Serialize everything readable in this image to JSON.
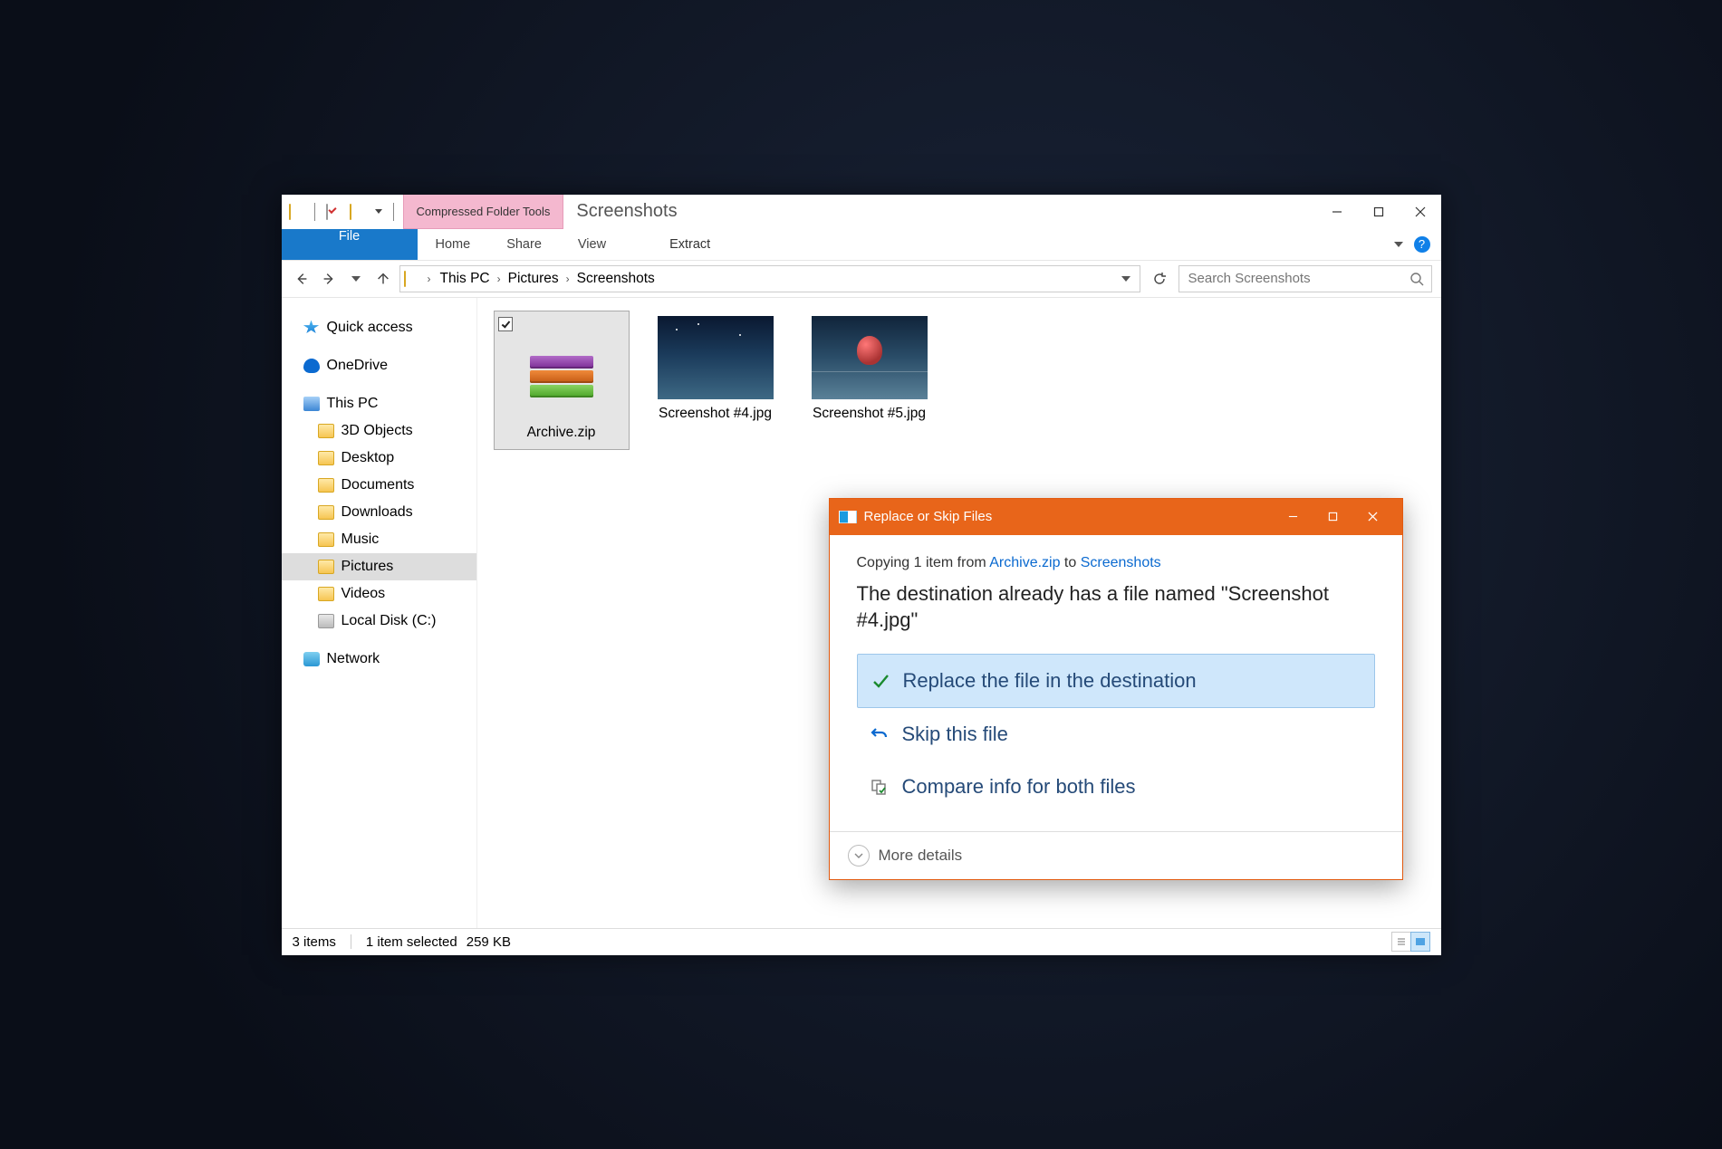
{
  "titlebar": {
    "window_title": "Screenshots",
    "contextual_label": "Compressed Folder Tools"
  },
  "ribbon": {
    "file": "File",
    "home": "Home",
    "share": "Share",
    "view": "View",
    "extract": "Extract"
  },
  "breadcrumbs": [
    "This PC",
    "Pictures",
    "Screenshots"
  ],
  "search": {
    "placeholder": "Search Screenshots"
  },
  "sidebar": {
    "quick_access": "Quick access",
    "onedrive": "OneDrive",
    "this_pc": "This PC",
    "children": {
      "objects3d": "3D Objects",
      "desktop": "Desktop",
      "documents": "Documents",
      "downloads": "Downloads",
      "music": "Music",
      "pictures": "Pictures",
      "videos": "Videos",
      "localdisk": "Local Disk (C:)"
    },
    "network": "Network"
  },
  "files": [
    {
      "name": "Archive.zip"
    },
    {
      "name": "Screenshot #4.jpg"
    },
    {
      "name": "Screenshot #5.jpg"
    }
  ],
  "status": {
    "count": "3 items",
    "selection": "1 item selected",
    "size": "259 KB"
  },
  "dialog": {
    "title": "Replace or Skip Files",
    "copy_prefix": "Copying 1 item from ",
    "copy_from": "Archive.zip",
    "copy_mid": " to ",
    "copy_to": "Screenshots",
    "message": "The destination already has a file named \"Screenshot #4.jpg\"",
    "opt_replace": "Replace the file in the destination",
    "opt_skip": "Skip this file",
    "opt_compare": "Compare info for both files",
    "more": "More details"
  }
}
